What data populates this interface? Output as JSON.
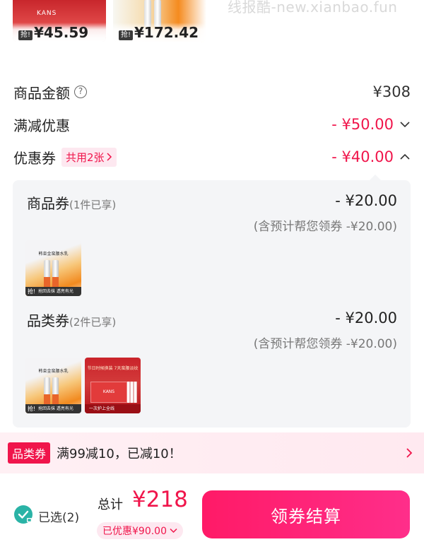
{
  "top_products": [
    {
      "grab": "抢!",
      "price": "¥45.59",
      "brand": "KANS"
    },
    {
      "grab": "抢!",
      "price": "¥172.42"
    }
  ],
  "watermark": "线报酷-new.xianbao.fun",
  "summary": {
    "goods_amount_label": "商品金额",
    "goods_amount_value": "¥308",
    "full_reduction_label": "满减优惠",
    "full_reduction_value": "- ¥50.00",
    "coupon_label": "优惠券",
    "coupon_share_tag": "共用2张",
    "coupon_value": "- ¥40.00"
  },
  "coupon_details": [
    {
      "title": "商品券",
      "sub": "(1件已享)",
      "amount": "- ¥20.00",
      "note": "(含预计帮您领券 -¥20.00)"
    },
    {
      "title": "品类券",
      "sub": "(2件已享)",
      "amount": "- ¥20.00",
      "note": "(含预计帮您领券 -¥20.00)"
    }
  ],
  "coupon_images": {
    "orange_text": "韩束金蛮腰水乳",
    "orange_grab": "抢!",
    "orange_caption": "抢回去抹  透亮有光",
    "red_text": "节日时候换装 7天蛮腰淡纹",
    "red_brand": "KANS",
    "red_caption": "一次护上全线"
  },
  "promo": {
    "tag": "品类券",
    "text": "满99减10，已减10！"
  },
  "bottom_bar": {
    "selected": "已选(2)",
    "total_label": "总计",
    "total_value": "¥218",
    "discount": "已优惠¥90.00",
    "pay_button": "领券结算"
  },
  "colors": {
    "accent": "#f0154b",
    "pay_button": "#ff1a67",
    "check": "#2ab3a6",
    "panel_bg": "#f4f5f7"
  }
}
